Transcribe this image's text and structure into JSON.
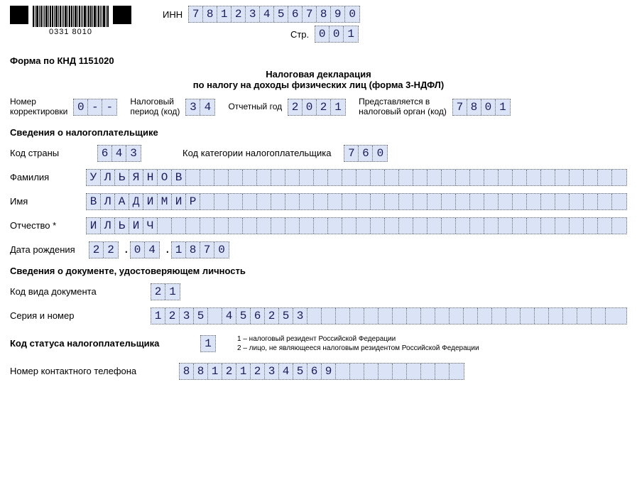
{
  "barcode_number": "0331  8010",
  "inn": {
    "label": "ИНН",
    "value": "781234567890"
  },
  "page": {
    "label": "Стр.",
    "value": "001"
  },
  "form_code": "Форма по КНД 1151020",
  "title_line1": "Налоговая декларация",
  "title_line2": "по налогу на доходы физических лиц (форма 3-НДФЛ)",
  "meta": {
    "correction": {
      "label": "Номер\nкорректировки",
      "value": "0--"
    },
    "tax_period": {
      "label": "Налоговый\nпериод (код)",
      "value": "34"
    },
    "report_year": {
      "label": "Отчетный год",
      "value": "2021"
    },
    "tax_office": {
      "label": "Представляется в\nналоговый орган (код)",
      "value": "7801"
    }
  },
  "taxpayer_section": "Сведения о налогоплательщике",
  "country_code": {
    "label": "Код страны",
    "value": "643"
  },
  "payer_category": {
    "label": "Код категории налогоплательщика",
    "value": "760"
  },
  "surname": {
    "label": "Фамилия",
    "value": "УЛЬЯНОВ"
  },
  "firstname": {
    "label": "Имя",
    "value": "ВЛАДИМИР"
  },
  "patronymic": {
    "label": "Отчество *",
    "value": "ИЛЬИЧ"
  },
  "birthdate": {
    "label": "Дата рождения",
    "day": "22",
    "month": "04",
    "year": "1870"
  },
  "id_section": "Сведения о документе, удостоверяющем личность",
  "doc_type": {
    "label": "Код вида документа",
    "value": "21"
  },
  "doc_serial": {
    "label": "Серия и номер",
    "value": "1235 456253"
  },
  "status_code": {
    "label": "Код статуса налогоплательщика",
    "value": "1",
    "legend1": "1 – налоговый резидент Российской Федерации",
    "legend2": "2 – лицо, не являющееся налоговым резидентом Российской Федерации"
  },
  "phone": {
    "label": "Номер контактного телефона",
    "value": "88121234569"
  }
}
